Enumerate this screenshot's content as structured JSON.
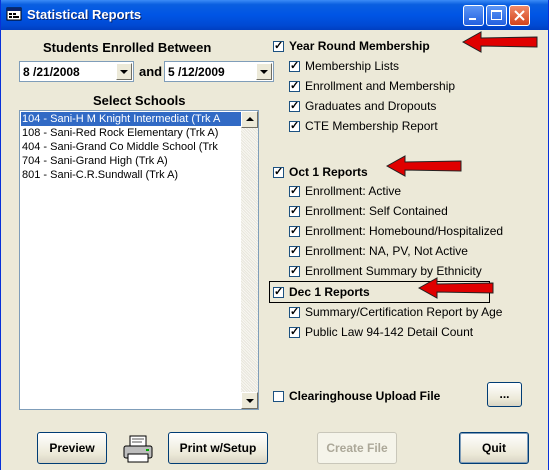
{
  "window": {
    "title": "Statistical Reports"
  },
  "students": {
    "heading": "Students Enrolled Between",
    "from_date": "8 /21/2008",
    "and_label": "and",
    "to_date": "5 /12/2009"
  },
  "schools": {
    "heading": "Select Schools",
    "items": [
      "104 - Sani-H M Knight Intermediat (Trk A",
      "108 - Sani-Red Rock Elementary (Trk A)",
      "404 - Sani-Grand Co Middle School (Trk",
      "704 - Sani-Grand High (Trk A)",
      "801 - Sani-C.R.Sundwall (Trk A)"
    ]
  },
  "year_round": {
    "label": "Year Round Membership",
    "items": [
      "Membership Lists",
      "Enrollment and Membership",
      "Graduates and Dropouts",
      "CTE Membership Report"
    ]
  },
  "oct1": {
    "label": "Oct 1 Reports",
    "items": [
      "Enrollment: Active",
      "Enrollment: Self Contained",
      "Enrollment: Homebound/Hospitalized",
      "Enrollment: NA, PV, Not Active",
      "Enrollment Summary by Ethnicity"
    ]
  },
  "dec1": {
    "label": "Dec 1 Reports",
    "items": [
      "Summary/Certification Report by Age",
      "Public Law 94-142 Detail Count"
    ]
  },
  "clearinghouse": {
    "label": "Clearinghouse Upload File",
    "browse_label": "..."
  },
  "buttons": {
    "preview": "Preview",
    "print_setup": "Print w/Setup",
    "create_file": "Create File",
    "quit": "Quit"
  },
  "colors": {
    "annotation_arrow": "#e00000",
    "selection": "#316ac5"
  }
}
